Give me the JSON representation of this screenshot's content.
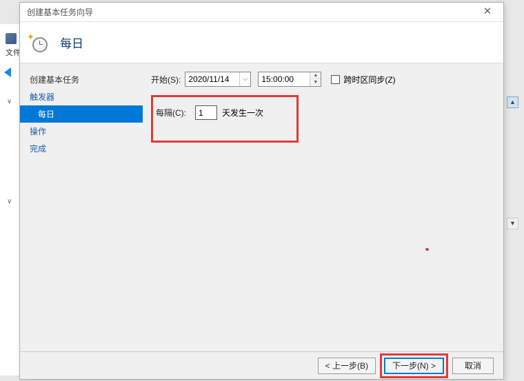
{
  "bg": {
    "text1": "文件",
    "expand1": "∨",
    "expand2": "∨",
    "scroll_up": "▲",
    "scroll_down": "▼"
  },
  "dialog": {
    "title": "创建基本任务向导",
    "close": "✕"
  },
  "header": {
    "title": "每日",
    "spark": "✦"
  },
  "sidebar": {
    "items": [
      {
        "label": "创建基本任务",
        "level": 1,
        "plain": true
      },
      {
        "label": "触发器",
        "level": 1
      },
      {
        "label": "每日",
        "level": 2,
        "selected": true
      },
      {
        "label": "操作",
        "level": 1
      },
      {
        "label": "完成",
        "level": 1
      }
    ]
  },
  "content": {
    "start_label": "开始(S):",
    "date_value": "2020/11/14",
    "date_arrow": "⌵",
    "time_value": "15:00:00",
    "spin_up": "▲",
    "spin_down": "▼",
    "sync_label": "跨时区同步(Z)",
    "recur_label": "每隔(C):",
    "recur_value": "1",
    "recur_suffix": "天发生一次"
  },
  "footer": {
    "back": "< 上一步(B)",
    "next": "下一步(N) >",
    "cancel": "取消"
  }
}
